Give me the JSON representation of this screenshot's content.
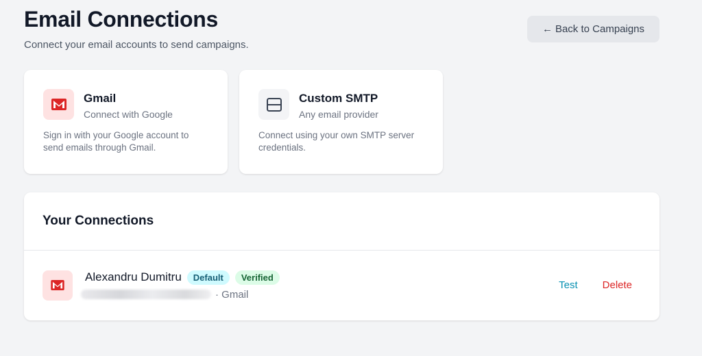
{
  "header": {
    "title": "Email Connections",
    "subtitle": "Connect your email accounts to send campaigns.",
    "back_arrow": "←",
    "back_label": "Back to Campaigns"
  },
  "providers": [
    {
      "name": "Gmail",
      "subtitle": "Connect with Google",
      "description": "Sign in with your Google account to send emails through Gmail.",
      "icon": "gmail-icon"
    },
    {
      "name": "Custom SMTP",
      "subtitle": "Any email provider",
      "description": "Connect using your own SMTP server credentials.",
      "icon": "server-icon"
    }
  ],
  "connections": {
    "title": "Your Connections",
    "items": [
      {
        "name": "Alexandru Dumitru",
        "badges": [
          "Default",
          "Verified"
        ],
        "provider_suffix": "· Gmail",
        "email_hidden": true,
        "actions": {
          "test": "Test",
          "delete": "Delete"
        },
        "icon": "gmail-icon"
      }
    ]
  },
  "colors": {
    "accent": "#0891b2",
    "danger": "#dc2626",
    "gmail_red": "#dc2626",
    "badge_default_bg": "#cffafe",
    "badge_verified_bg": "#dcfce7"
  }
}
